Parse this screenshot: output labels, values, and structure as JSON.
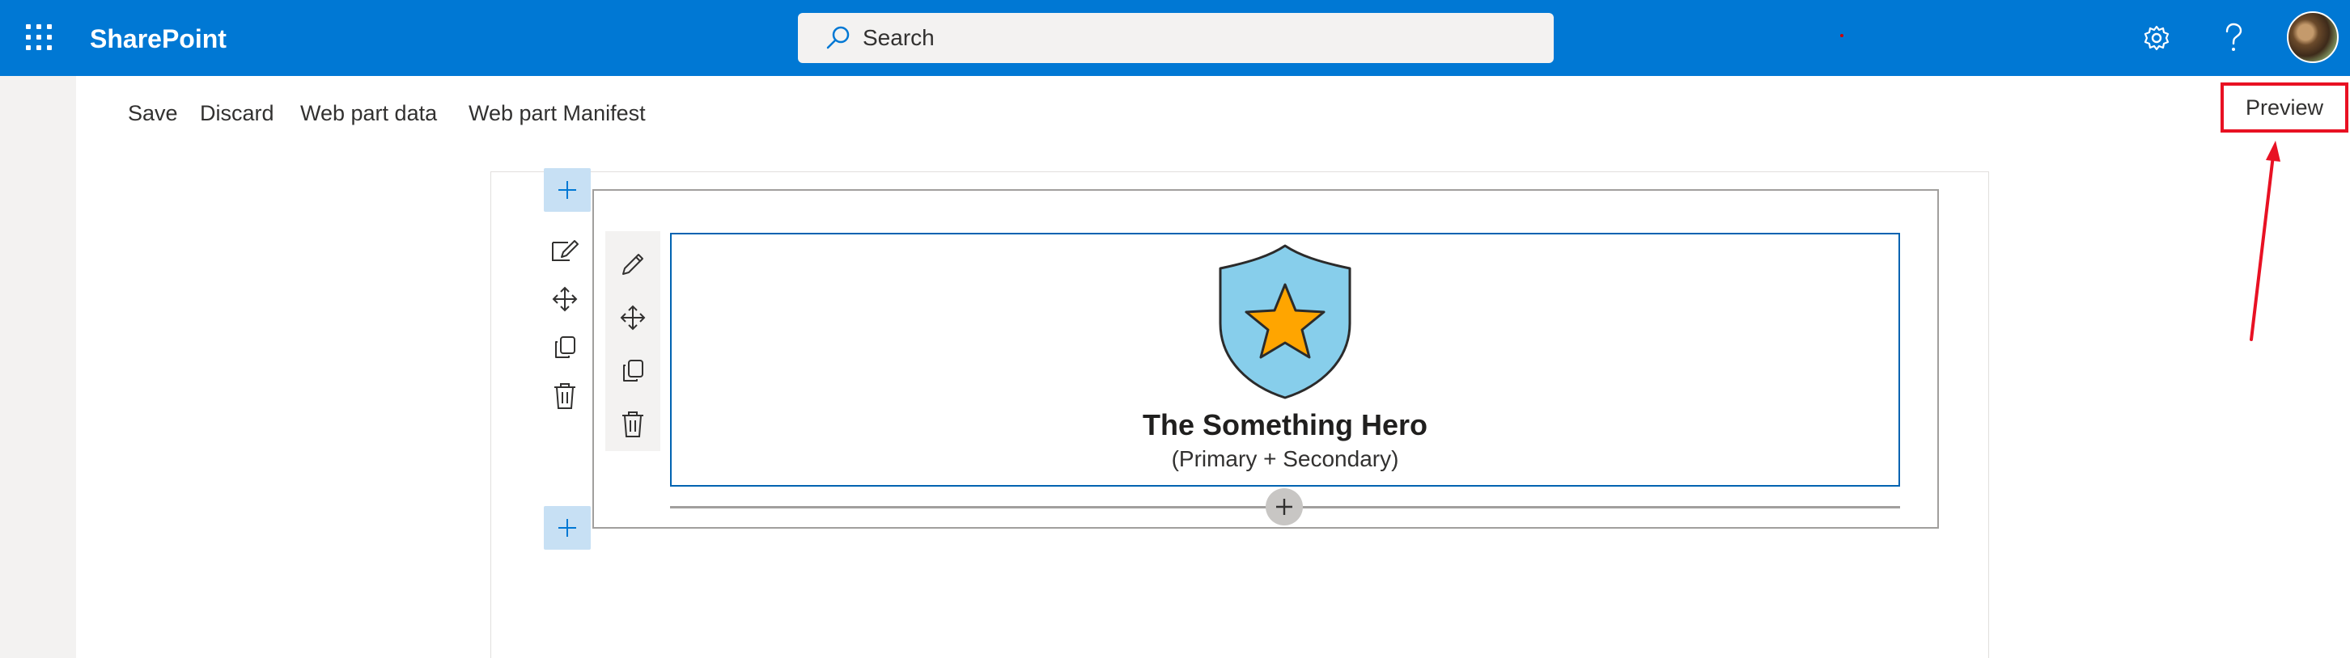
{
  "suite_bar": {
    "brand": "SharePoint",
    "search_placeholder": "Search",
    "icons": [
      "waffle-icon",
      "search-icon",
      "settings-gear-icon",
      "help-question-icon",
      "user-avatar"
    ]
  },
  "command_bar": {
    "save": "Save",
    "discard": "Discard",
    "web_part_data": "Web part data",
    "web_part_manifest": "Web part Manifest",
    "preview": "Preview"
  },
  "web_part": {
    "title": "The Something Hero",
    "subtitle": "(Primary + Secondary)",
    "icon": "shield-star-icon"
  },
  "colors": {
    "suite_bar": "#0078d4",
    "highlight": "#e81123",
    "web_part_border": "#0063b1",
    "shield_fill": "#87ceeb",
    "star_fill": "#ffa500"
  }
}
